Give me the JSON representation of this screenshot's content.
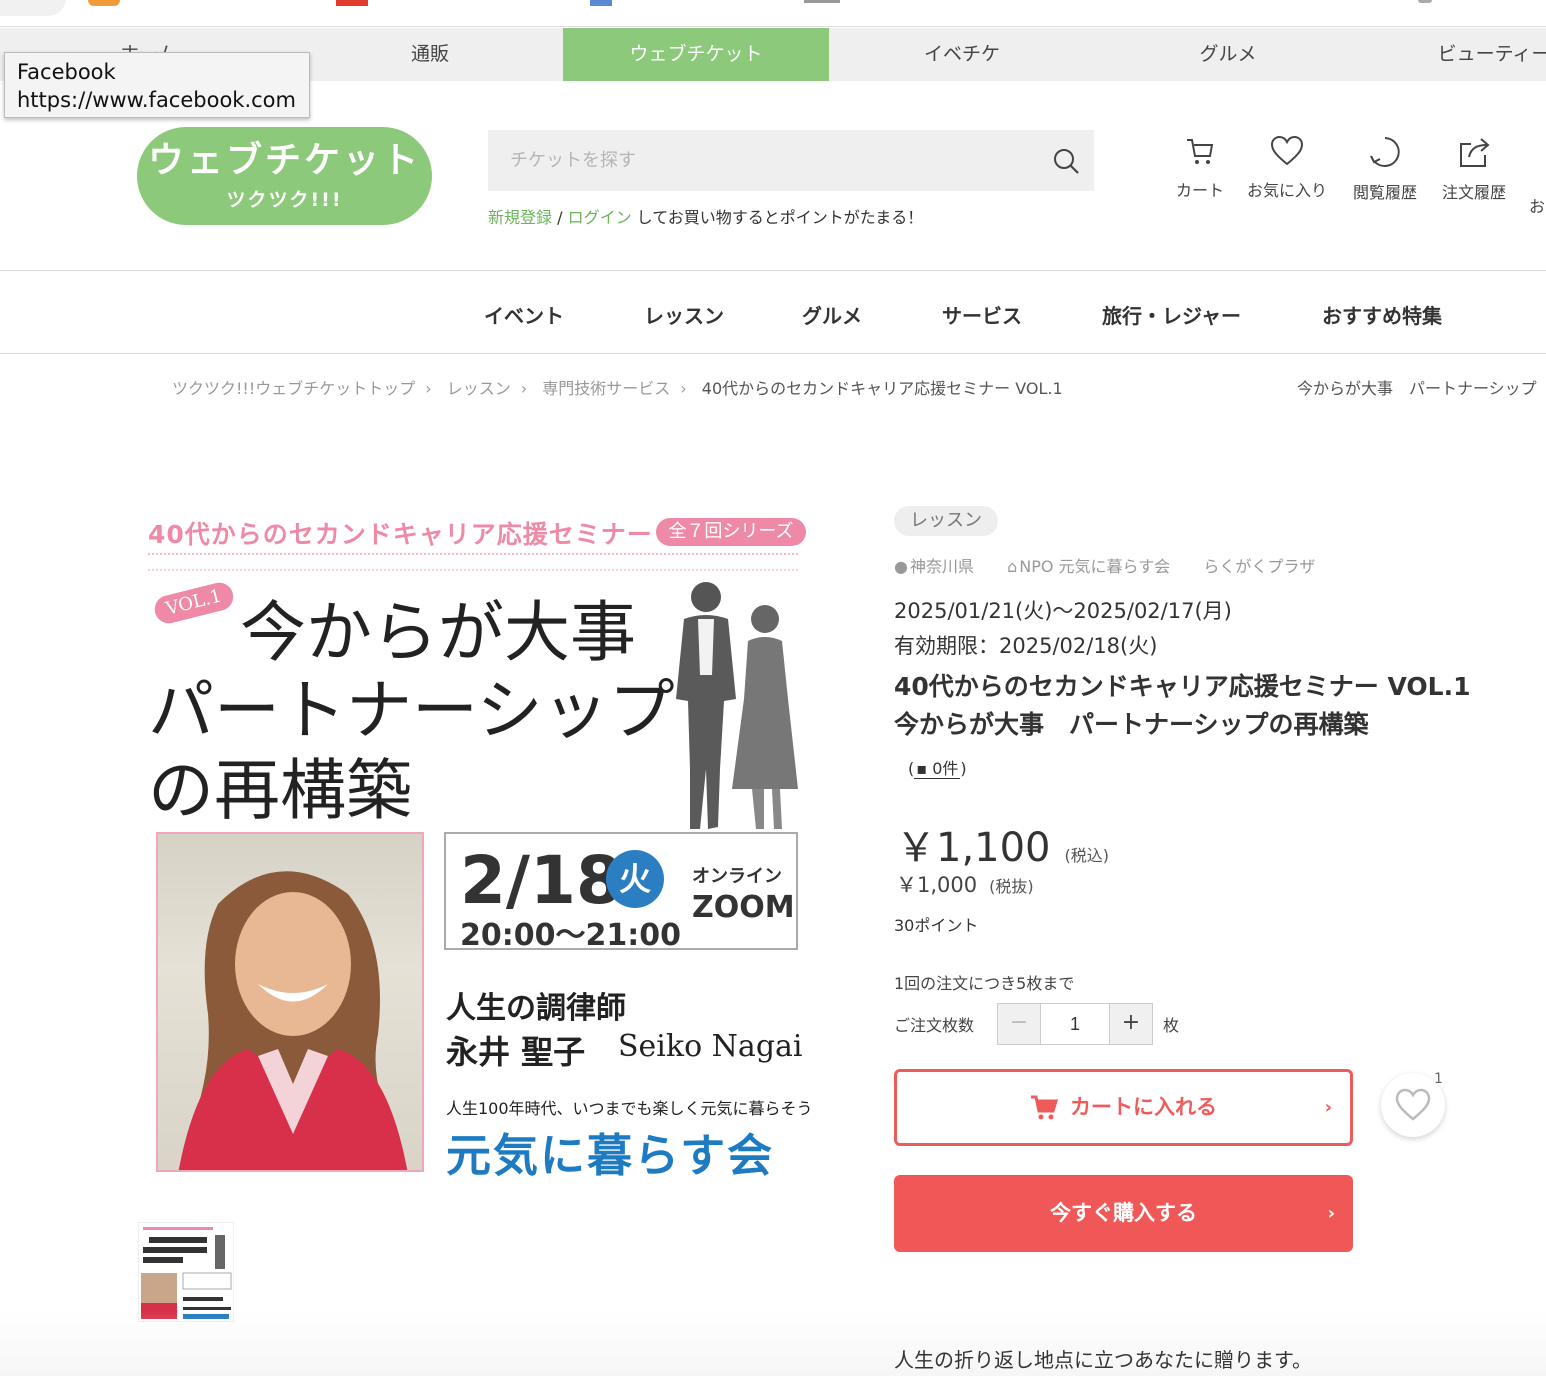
{
  "tooltip": {
    "line1": "Facebook",
    "line2": "https://www.facebook.com"
  },
  "topnav": {
    "items": [
      {
        "label": "ホーム"
      },
      {
        "label": "通販"
      },
      {
        "label": "ウェブチケット"
      },
      {
        "label": "イベチケ"
      },
      {
        "label": "グルメ"
      },
      {
        "label": "ビューティー"
      }
    ],
    "active_index": 2
  },
  "logo": {
    "line1": "ウェブチケット",
    "line2": "ツクツク!!!"
  },
  "search": {
    "placeholder": "チケットを探す"
  },
  "login": {
    "register": "新規登録",
    "sep": " / ",
    "login": "ログイン",
    "rest": " してお買い物するとポイントがたまる！"
  },
  "header_icons": [
    {
      "label": "カート",
      "icon": "cart-icon"
    },
    {
      "label": "お気に入り",
      "icon": "heart-icon"
    },
    {
      "label": "閲覧履歴",
      "icon": "history-icon"
    },
    {
      "label": "注文履歴",
      "icon": "share-icon"
    },
    {
      "label": "お"
    }
  ],
  "subnav": [
    "イベント",
    "レッスン",
    "グルメ",
    "サービス",
    "旅行・レジャー",
    "おすすめ特集"
  ],
  "breadcrumb": {
    "items": [
      "ツクツク!!!ウェブチケットトップ",
      "レッスン",
      "専門技術サービス",
      "40代からのセカンドキャリア応援セミナー VOL.1"
    ],
    "right": "今からが大事　パートナーシップ"
  },
  "flyer": {
    "series_title": "40代からのセカンドキャリア応援セミナー",
    "series_badge": "全７回シリーズ",
    "vol": "VOL.1",
    "headline1": "今からが大事",
    "headline2": "パートナーシップ",
    "headline3": "の再構築",
    "date": "2/18",
    "dow": "火",
    "time": "20:00〜21:00",
    "online": "オンライン",
    "zoom": "ZOOM",
    "role": "人生の調律師",
    "name": "永井 聖子",
    "name_en": "Seiko Nagai",
    "tagline": "人生100年時代、いつまでも楽しく元気に暮らそう",
    "org": "元気に暮らす会"
  },
  "product": {
    "category_tag": "レッスン",
    "location": {
      "pref": "神奈川県",
      "org": "NPO 元気に暮らす会",
      "venue": "らくがくプラザ"
    },
    "period": "2025/01/21(火)〜2025/02/17(月)",
    "expiry": "有効期限：2025/02/18(火)",
    "title_line1": "40代からのセカンドキャリア応援セミナー VOL.1",
    "title_line2": "今からが大事　パートナーシップの再構築",
    "reviews": "0件",
    "price_incl": "￥1,100",
    "price_incl_note": "(税込)",
    "price_excl": "￥1,000",
    "price_excl_note": "(税抜)",
    "points": "30ポイント",
    "limit": "1回の注文につき5枚まで",
    "qty_label": "ご注文枚数",
    "qty_value": "1",
    "qty_unit": "枚",
    "minus": "−",
    "plus": "+",
    "add_to_cart": "カートに入れる",
    "buy_now": "今すぐ購入する",
    "chevron": "›",
    "fav_count": "1",
    "description": "人生の折り返し地点に立つあなたに贈ります。"
  },
  "colors": {
    "brand_green": "#8cc97b",
    "accent_red": "#f05858",
    "flyer_pink": "#ee8aa6",
    "flyer_blue": "#1e7bc2"
  }
}
